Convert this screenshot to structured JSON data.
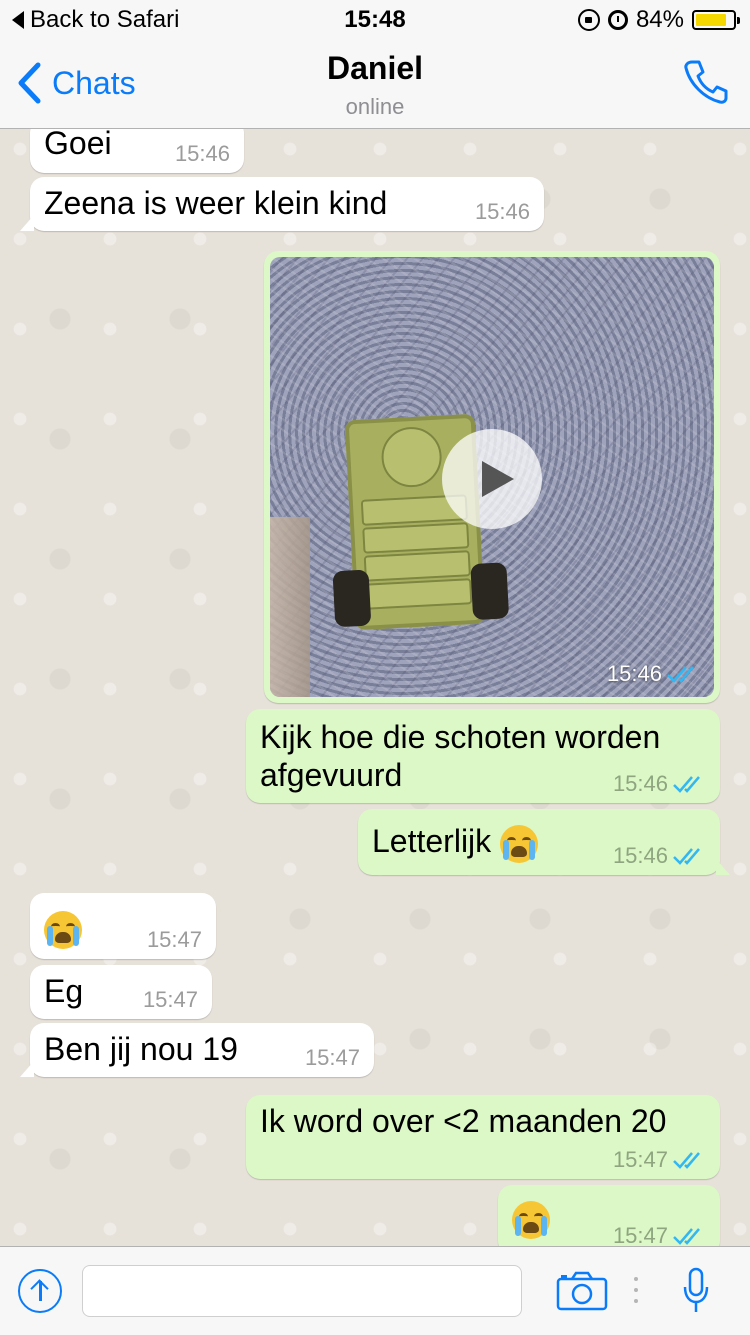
{
  "status_bar": {
    "back_label": "Back to Safari",
    "time": "15:48",
    "battery": "84%",
    "battery_level": 0.84
  },
  "header": {
    "back_label": "Chats",
    "title": "Daniel",
    "subtitle": "online"
  },
  "messages": [
    {
      "direction": "in",
      "text": "Goei",
      "time": "15:46"
    },
    {
      "direction": "in",
      "text": "Zeena is weer klein kind",
      "time": "15:46"
    },
    {
      "direction": "out",
      "type": "video",
      "time": "15:46",
      "read": true
    },
    {
      "direction": "out",
      "text": "Kijk hoe die schoten worden",
      "text2": "afgevuurd",
      "time": "15:46",
      "read": true
    },
    {
      "direction": "out",
      "text": "Letterlijk",
      "emoji": "crying-face",
      "time": "15:46",
      "read": true
    },
    {
      "direction": "in",
      "emoji": "crying-face",
      "time": "15:47"
    },
    {
      "direction": "in",
      "text": "Eg",
      "time": "15:47"
    },
    {
      "direction": "in",
      "text": "Ben jij nou 19",
      "time": "15:47"
    },
    {
      "direction": "out",
      "text": "Ik word over <2 maanden 20",
      "time": "15:47",
      "read": true
    },
    {
      "direction": "out",
      "emoji": "crying-face",
      "time": "15:47",
      "read": true
    }
  ],
  "input_bar": {
    "placeholder": "",
    "icons": [
      "upload-icon",
      "camera-icon",
      "microphone-icon"
    ]
  },
  "colors": {
    "accent": "#0b7cf9",
    "outgoing": "#dcf8c6",
    "incoming": "#ffffff",
    "read_tick": "#34b7f1"
  }
}
